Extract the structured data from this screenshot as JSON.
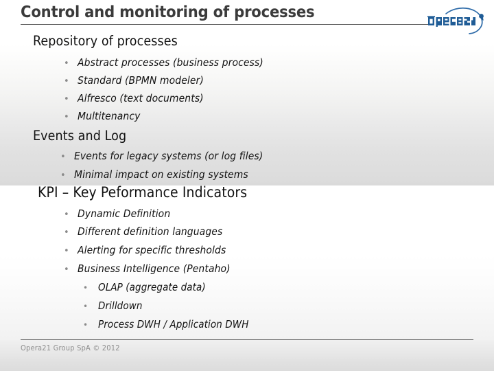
{
  "slide": {
    "title": "Control and monitoring of processes",
    "colors": {
      "title_text": "#3b3b3b",
      "body_text": "#111111",
      "bullet_marker": "#8a8a8a",
      "rule": "#4d4d4d",
      "footer_text": "#8d8d8d",
      "logo_blue": "#1f5c96",
      "logo_arc": "#2c6aa8"
    },
    "logo": {
      "wordmark": "Opera21",
      "icon_name": "opera21-logo"
    },
    "sections": [
      {
        "heading": "Repository of processes",
        "bullets": [
          {
            "level": 2,
            "marker": "•",
            "text": "Abstract processes (business process)"
          },
          {
            "level": 2,
            "marker": "•",
            "text": "Standard (BPMN modeler)"
          },
          {
            "level": 2,
            "marker": "•",
            "text": "Alfresco (text documents)"
          },
          {
            "level": 2,
            "marker": "•",
            "text": "Multitenancy"
          }
        ]
      },
      {
        "heading": "Events and Log",
        "bullets": [
          {
            "level": 2,
            "marker": "•",
            "text": "Events for legacy systems (or log files)"
          },
          {
            "level": 2,
            "marker": "•",
            "text": "Minimal impact on existing systems"
          }
        ]
      },
      {
        "heading": "KPI – Key Peformance Indicators",
        "bullets": [
          {
            "level": 2,
            "marker": "•",
            "text": "Dynamic Definition"
          },
          {
            "level": 2,
            "marker": "•",
            "text": "Different definition languages"
          },
          {
            "level": 2,
            "marker": "•",
            "text": "Alerting for specific thresholds"
          },
          {
            "level": 2,
            "marker": "•",
            "text": "Business Intelligence (Pentaho)"
          },
          {
            "level": 3,
            "marker": "•",
            "text": "OLAP (aggregate data)"
          },
          {
            "level": 3,
            "marker": "•",
            "text": "Drilldown"
          },
          {
            "level": 3,
            "marker": "•",
            "text": "Process DWH / Application DWH"
          }
        ]
      }
    ],
    "footer": {
      "text": "Opera21 Group SpA © 2012"
    }
  }
}
